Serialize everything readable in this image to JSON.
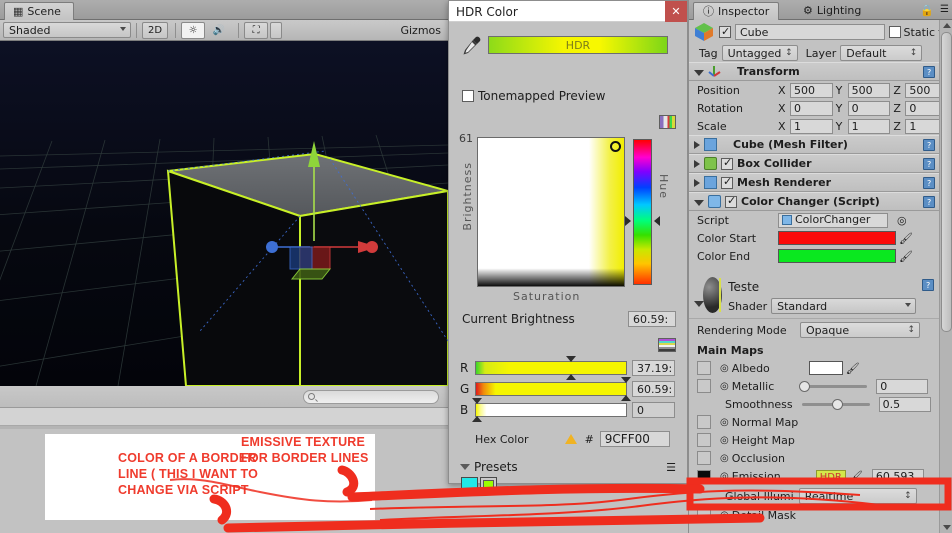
{
  "scene": {
    "tab_label": "Scene",
    "tab_icon": "grid-icon",
    "shading_mode": "Shaded",
    "mode_2d": "2D",
    "lighting_icon": "sun-icon",
    "audio_icon": "speaker-icon",
    "fx_icon": "image-icon",
    "gizmos_label": "Gizmos",
    "search_placeholder": ""
  },
  "hdr": {
    "title": "HDR Color",
    "close_label": "✕",
    "eyedropper_icon": "eyedropper-icon",
    "hdr_bar_label": "HDR",
    "tonemapped_label": "Tonemapped Preview",
    "tonemapped_checked": false,
    "brightness_value_top": "61",
    "brightness_axis_label": "Brightness",
    "saturation_axis_label": "Saturation",
    "hue_axis_label": "Hue",
    "current_brightness_label": "Current Brightness",
    "current_brightness_value": "60.59:",
    "channels": [
      {
        "letter": "R",
        "value": "37.19:",
        "pct": 62
      },
      {
        "letter": "G",
        "value": "60.59:",
        "pct": 98
      },
      {
        "letter": "B",
        "value": "0",
        "pct": 1
      }
    ],
    "hex_label": "Hex Color",
    "hex_hash": "#",
    "hex_value": "9CFF00",
    "warning_icon": "warning-triangle-icon",
    "presets_label": "Presets",
    "presets_menu_icon": "menu-icon",
    "preset_colors": [
      "#22e8e8",
      "#9CFF00"
    ]
  },
  "inspector": {
    "tabs": [
      {
        "label": "Inspector",
        "icon": "info-icon",
        "active": true
      },
      {
        "label": "Lighting",
        "icon": "lighting-icon",
        "active": false
      }
    ],
    "lock_icon": "lock-icon",
    "menu_icon": "kebab-menu-icon",
    "object": {
      "enabled": true,
      "name": "Cube",
      "static_label": "Static",
      "static_checked": false,
      "tag_label": "Tag",
      "tag_value": "Untagged",
      "layer_label": "Layer",
      "layer_value": "Default"
    },
    "transform": {
      "title": "Transform",
      "rows": [
        {
          "label": "Position",
          "x": "500",
          "y": "500",
          "z": "500"
        },
        {
          "label": "Rotation",
          "x": "0",
          "y": "0",
          "z": "0"
        },
        {
          "label": "Scale",
          "x": "1",
          "y": "1",
          "z": "1"
        }
      ]
    },
    "components": [
      {
        "title": "Cube (Mesh Filter)",
        "has_checkbox": false,
        "checked": false,
        "icon": "mesh-filter-icon"
      },
      {
        "title": "Box Collider",
        "has_checkbox": true,
        "checked": true,
        "icon": "box-collider-icon"
      },
      {
        "title": "Mesh Renderer",
        "has_checkbox": true,
        "checked": true,
        "icon": "mesh-renderer-icon"
      },
      {
        "title": "Color Changer (Script)",
        "has_checkbox": true,
        "checked": true,
        "icon": "script-icon"
      }
    ],
    "script": {
      "script_label": "Script",
      "script_value": "ColorChanger",
      "color_start_label": "Color Start",
      "color_start_value": "#ff0000",
      "color_end_label": "Color End",
      "color_end_value": "#00e822"
    },
    "material": {
      "name": "Teste",
      "shader_label": "Shader",
      "shader_value": "Standard",
      "rendering_mode_label": "Rendering Mode",
      "rendering_mode_value": "Opaque",
      "main_maps_label": "Main Maps",
      "albedo_label": "Albedo",
      "albedo_color": "#ffffff",
      "metallic_label": "Metallic",
      "metallic_value": "0",
      "smoothness_label": "Smoothness",
      "smoothness_value": "0.5",
      "normal_map_label": "Normal Map",
      "height_map_label": "Height Map",
      "occlusion_label": "Occlusion",
      "emission_label": "Emission",
      "emission_hdr_tag": "HDR",
      "emission_value": "60.593",
      "global_illum_label": "Global Illumi",
      "global_illum_value": "Realtime",
      "detail_mask_label": "Detail Mask"
    }
  },
  "annotation": {
    "note1_line1": "COLOR OF A BORDER",
    "note1_line2": "LINE ( THIS I WANT TO",
    "note1_line3": "CHANGE VIA SCRIPT",
    "note2_line1": "EMISSIVE TEXTURE",
    "note2_line2": "FOR BORDER LINES",
    "ink_color": "#ef3b2d"
  }
}
